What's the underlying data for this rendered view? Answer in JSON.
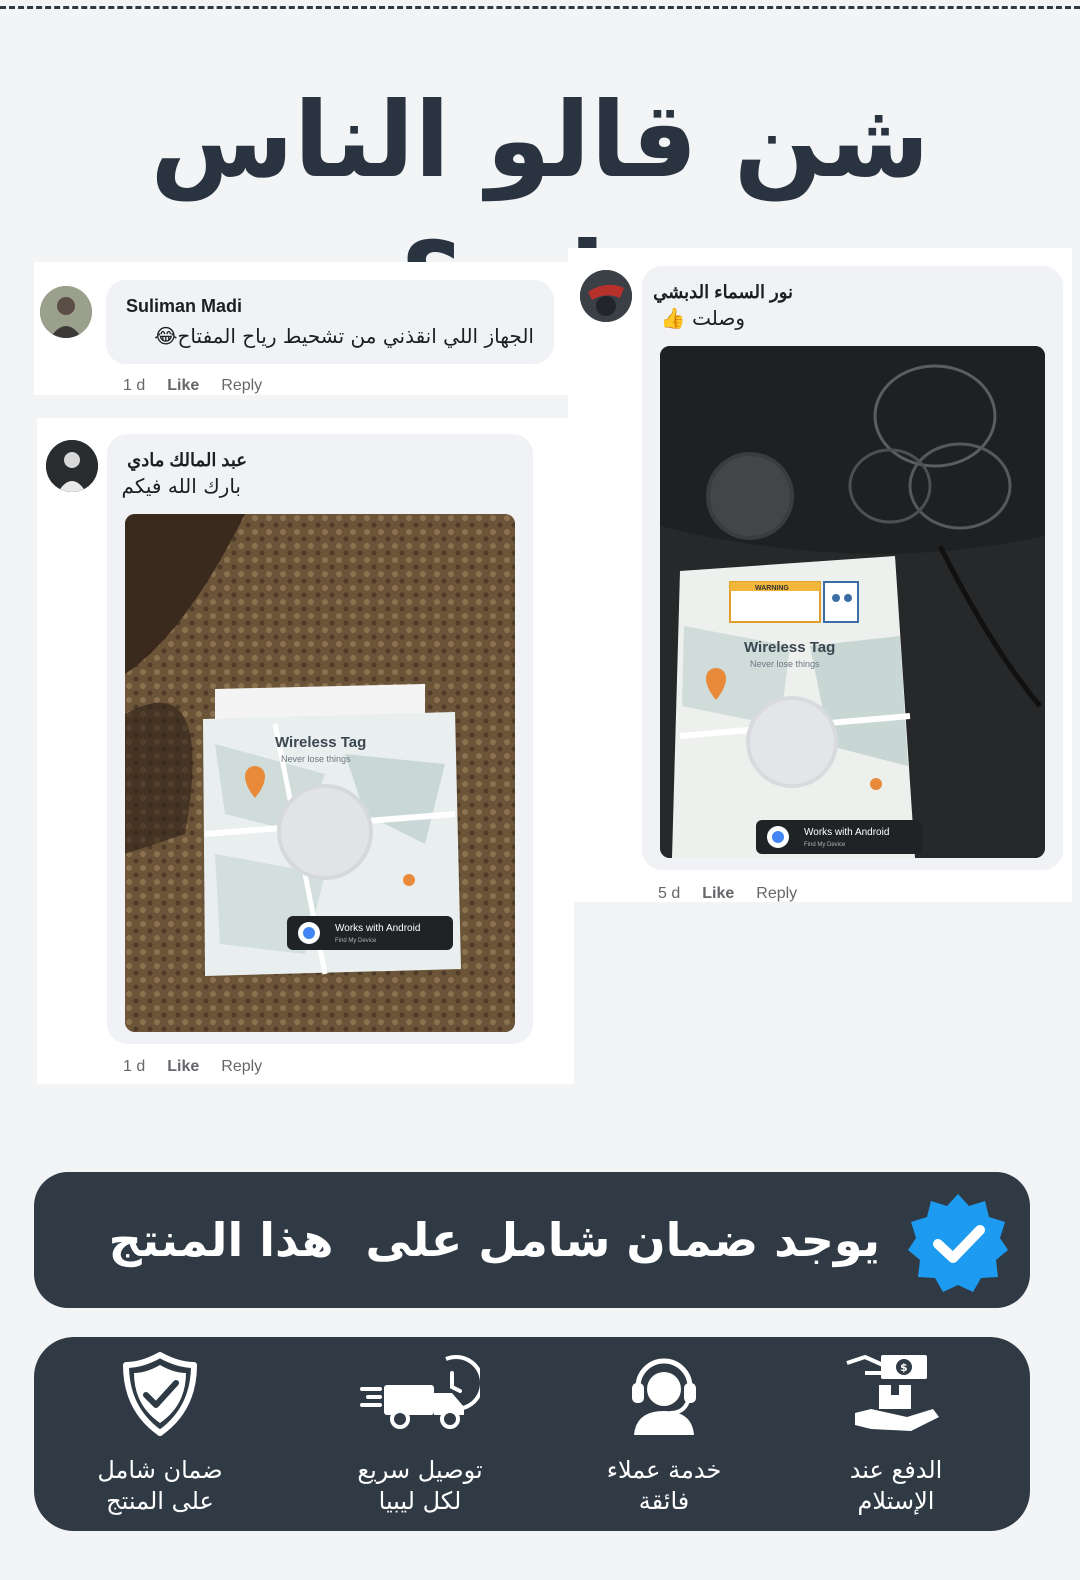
{
  "headline": "شن قالو الناس عليه؟",
  "comments": [
    {
      "name": "Suliman Madi",
      "text": "الجهاز اللي انقذني من تشحيط رياح المفتاح😂",
      "time": "1 d",
      "like": "Like",
      "reply": "Reply"
    },
    {
      "name": "عبد المالك مادي",
      "text": "بارك الله فيكم",
      "time": "1 d",
      "like": "Like",
      "reply": "Reply",
      "photo": {
        "title": "Wireless Tag",
        "subtitle": "Never lose things",
        "badge": "Works with Android",
        "badge_sub": "Find My Device"
      }
    },
    {
      "name": "نور السماء الدبشي",
      "text": "وصلت 👍",
      "time": "5 d",
      "like": "Like",
      "reply": "Reply",
      "photo": {
        "title": "Wireless Tag",
        "subtitle": "Never lose things",
        "badge": "Works with Android",
        "badge_sub": "Find My Device",
        "warning": "WARNING"
      }
    }
  ],
  "warranty": {
    "text": "يوجد ضمان شامل على  هذا المنتج",
    "badge_icon": "verified-check-icon",
    "colors": {
      "panel": "#2f3a45",
      "badge": "#1d9bf0"
    }
  },
  "features": [
    {
      "icon": "shield-check-icon",
      "line1": "ضمان شامل",
      "line2": "على المنتج"
    },
    {
      "icon": "delivery-truck-icon",
      "line1": "توصيل سريع",
      "line2": "لكل ليبيا"
    },
    {
      "icon": "customer-support-icon",
      "line1": "خدمة  عملاء",
      "line2": "فائقة"
    },
    {
      "icon": "cash-on-delivery-icon",
      "line1": "الدفع عند",
      "line2": "الإستلام"
    }
  ]
}
